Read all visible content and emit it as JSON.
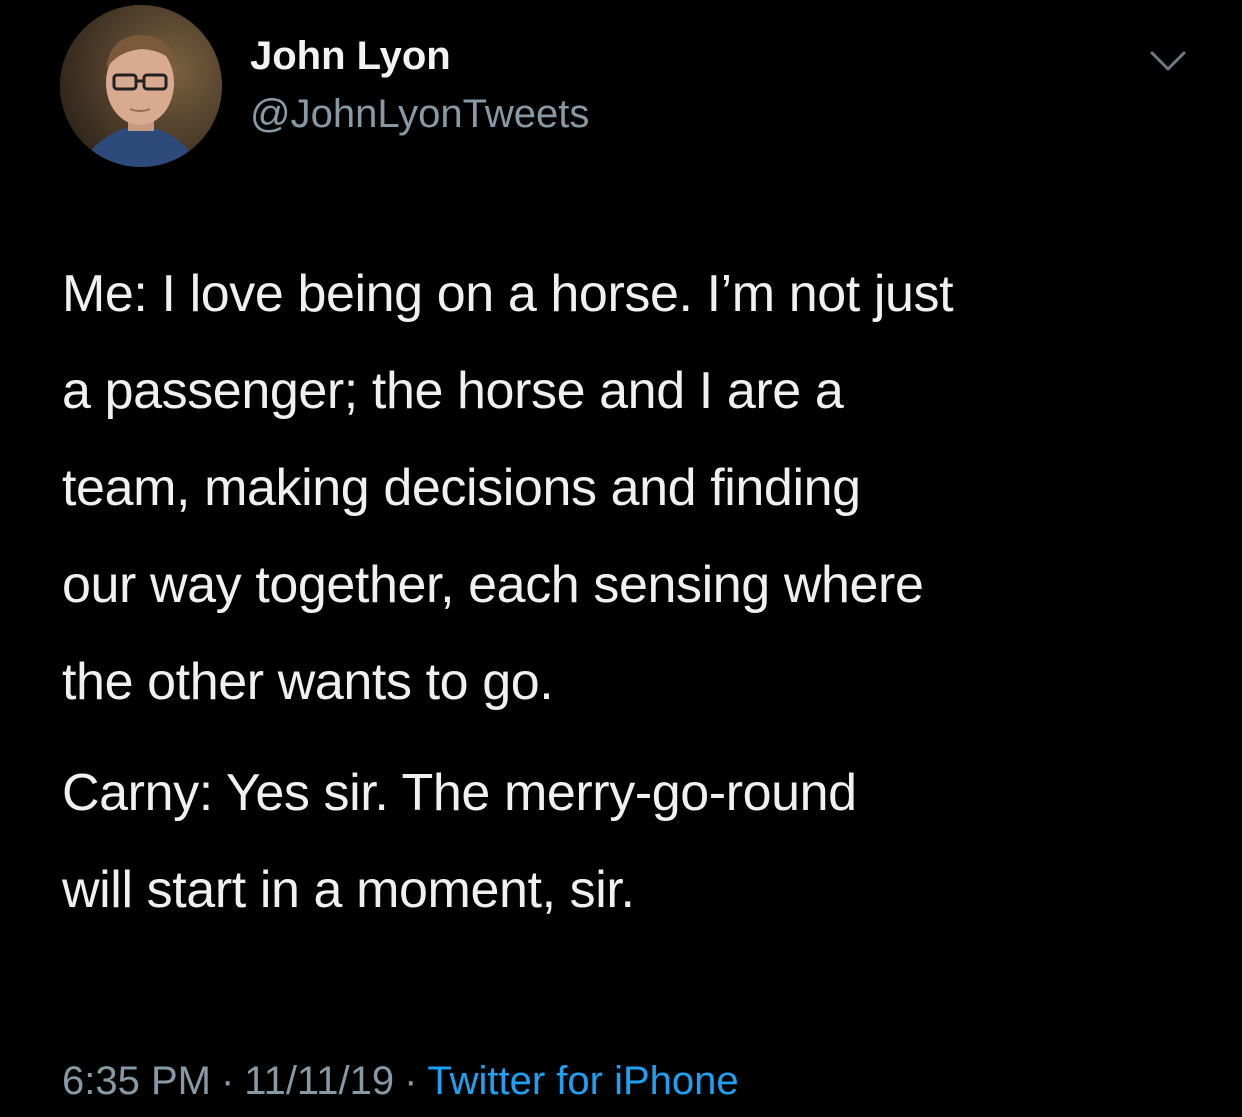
{
  "author": {
    "display_name": "John Lyon",
    "handle": "@JohnLyonTweets"
  },
  "tweet": {
    "lines": [
      [
        "Me: I love being on a horse. I’m not just",
        "a passenger; the horse and I are a",
        "team, making decisions and finding",
        "our way together, each sensing where",
        "the other wants to go."
      ],
      [
        "Carny: Yes sir. The merry-go-round",
        "will start in a moment, sir."
      ]
    ]
  },
  "meta": {
    "time": "6:35 PM",
    "date": "11/11/19",
    "source": "Twitter for iPhone",
    "separator": "·"
  },
  "colors": {
    "background": "#000000",
    "secondary_text": "#8899a6",
    "link": "#1da1f2"
  },
  "icons": {
    "more": "chevron-down-icon"
  }
}
